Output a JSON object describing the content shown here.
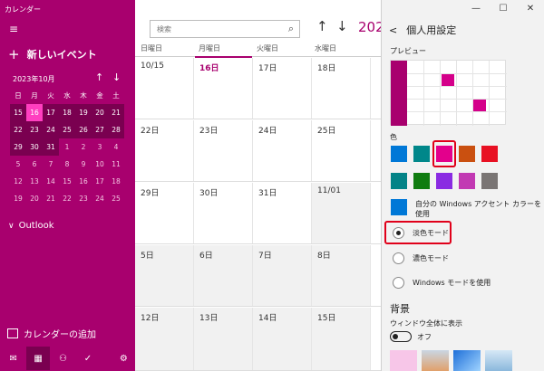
{
  "app": {
    "title": "カレンダー"
  },
  "sidebar": {
    "new_event": "新しいイベント",
    "month": "2023年10月",
    "weekdays": [
      "日",
      "月",
      "火",
      "水",
      "木",
      "金",
      "土"
    ],
    "weeks": [
      [
        "15",
        "16",
        "17",
        "18",
        "19",
        "20",
        "21"
      ],
      [
        "22",
        "23",
        "24",
        "25",
        "26",
        "27",
        "28"
      ],
      [
        "29",
        "30",
        "31",
        "1",
        "2",
        "3",
        "4"
      ],
      [
        "5",
        "6",
        "7",
        "8",
        "9",
        "10",
        "11"
      ],
      [
        "12",
        "13",
        "14",
        "15",
        "16",
        "17",
        "18"
      ],
      [
        "19",
        "20",
        "21",
        "22",
        "23",
        "24",
        "25"
      ]
    ],
    "outlook": "Outlook",
    "add_calendar": "カレンダーの追加",
    "accent": "#a8006e"
  },
  "main": {
    "search_placeholder": "検索",
    "year_partial": "202",
    "dow": [
      "日曜日",
      "月曜日",
      "火曜日",
      "水曜日"
    ],
    "weeks": [
      [
        "10/15",
        "16日",
        "17日",
        "18日"
      ],
      [
        "22日",
        "23日",
        "24日",
        "25日"
      ],
      [
        "29日",
        "30日",
        "31日",
        "11/01"
      ],
      [
        "5日",
        "6日",
        "7日",
        "8日"
      ],
      [
        "12日",
        "13日",
        "14日",
        "15日"
      ]
    ]
  },
  "panel": {
    "title": "個人用設定",
    "preview_label": "プレビュー",
    "color_label": "色",
    "accent_text": "自分の Windows アクセント カラーを使用",
    "modes": [
      "淡色モード",
      "濃色モード",
      "Windows モードを使用"
    ],
    "background_head": "背景",
    "background_sub": "ウィンドウ全体に表示",
    "toggle_label": "オフ",
    "colors_row1": [
      "#0078d7",
      "#00878a",
      "#e3008c",
      "#ca5010",
      "#e81123"
    ],
    "colors_row2": [
      "#038387",
      "#107c10",
      "#8a2be2",
      "#c239b3",
      "#7a7574"
    ]
  }
}
